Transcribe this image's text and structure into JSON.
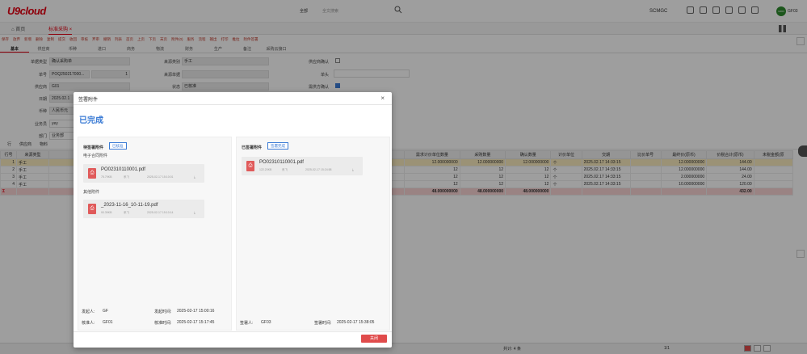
{
  "header": {
    "logo": "U9cloud",
    "search_scope": "全部",
    "search_placeholder": "全文搜索",
    "org": "SCMGC",
    "avatar": "GF03",
    "user": "GF03"
  },
  "tabs": {
    "home": "首页",
    "active": "标准采购"
  },
  "toolbar": [
    "保存",
    "放弃",
    "新增",
    "删除",
    "复制",
    "提交",
    "收回",
    "审核",
    "弃审",
    "撤销",
    "列表",
    "首页",
    "上页",
    "下页",
    "末页",
    "附件(0)",
    "服务",
    "流程",
    "输出",
    "打印",
    "推拉",
    "附件签署"
  ],
  "form_tabs": [
    "基本",
    "供应商",
    "币种",
    "进口",
    "商务",
    "物流",
    "财务",
    "生产",
    "备注",
    "采购云接口"
  ],
  "form": {
    "doc_type_label": "单据类型",
    "doc_type": "确认采购单",
    "doc_no_label": "单号",
    "doc_no": "POQ250217000...",
    "version": "1",
    "supplier_label": "供应商",
    "supplier": "G01",
    "date_label": "日期",
    "date": "2025.02.1",
    "currency_label": "币种",
    "currency": "人民币元",
    "buyer_label": "业务员",
    "buyer": "yey",
    "dept_label": "部门",
    "dept": "业务部",
    "source_type_label": "来源类别",
    "source_type": "手工",
    "source_doc_label": "来源单据",
    "source_doc": "",
    "status_label": "状态",
    "status": "已核准",
    "supplier_confirm_label": "供应商确认",
    "head_label": "单头",
    "need_confirm_label": "需供方确认"
  },
  "grid_tabs": [
    "行",
    "供应商",
    "物料"
  ],
  "grid": {
    "columns": [
      "行号",
      "来源类型",
      "",
      "需求计价单位数量",
      "采购数量",
      "确认数量",
      "计价单位",
      "交期",
      "比价单号",
      "最终价(原币)",
      "价税合计(原币)",
      "未税金额(原"
    ],
    "rows": [
      {
        "no": "1",
        "src": "手工",
        "qty": "12.000000000",
        "pq": "12.000000000",
        "cq": "12.000000000",
        "unit": "个",
        "date": "2025.02.17 14:33:15",
        "cmp": "",
        "price": "12.000000000",
        "total": "144.00"
      },
      {
        "no": "2",
        "src": "手工",
        "qty": "12",
        "pq": "12",
        "cq": "12",
        "unit": "个",
        "date": "2025.02.17 14:33:15",
        "cmp": "",
        "price": "12.000000000",
        "total": "144.00"
      },
      {
        "no": "3",
        "src": "手工",
        "qty": "12",
        "pq": "12",
        "cq": "12",
        "unit": "个",
        "date": "2025.02.17 14:33:15",
        "cmp": "",
        "price": "2.000000000",
        "total": "24.00"
      },
      {
        "no": "4",
        "src": "手工",
        "qty": "12",
        "pq": "12",
        "cq": "12",
        "unit": "个",
        "date": "2025.02.17 14:33:15",
        "cmp": "",
        "price": "10.000000000",
        "total": "120.00"
      }
    ],
    "sum": {
      "mark": "Σ",
      "qty": "48.000000000",
      "pq": "48.000000000",
      "cq": "48.000000000",
      "total": "432.00"
    }
  },
  "bottom": {
    "count": "共计: 4 条",
    "pages": "1/1"
  },
  "modal": {
    "title": "签署附件",
    "status": "已完成",
    "left": {
      "heading": "待签署附件",
      "badge": "已核准",
      "section1": "电子合同附件",
      "file1": {
        "name": "PO02310110001.pdf",
        "size": "75.79KB",
        "user": "系飞",
        "time": "2025-02-17 15:10:01"
      },
      "section2": "其他附件",
      "file2": {
        "name": "_2023-11-16_10-11-19.pdf",
        "size": "90.39KB",
        "user": "系飞",
        "time": "2025-02-17 15:10:14"
      },
      "initiator_label": "发起人:",
      "initiator": "GF",
      "init_time_label": "发起时间:",
      "init_time": "2025-02-17 15:00:16",
      "approver_label": "核准人:",
      "approver": "GF01",
      "approve_time_label": "核准时间:",
      "approve_time": "2025-02-17 15:17:45"
    },
    "right": {
      "heading": "已签署附件",
      "badge": "签署完成",
      "file1": {
        "name": "PO02310110001.pdf",
        "size": "122.20KB",
        "user": "系飞",
        "time": "2025-02-17 15:24:58"
      },
      "signer_label": "签署人:",
      "signer": "GF03",
      "sign_time_label": "签署时间:",
      "sign_time": "2025-02-17 15:38:05"
    },
    "close_button": "关闭"
  }
}
